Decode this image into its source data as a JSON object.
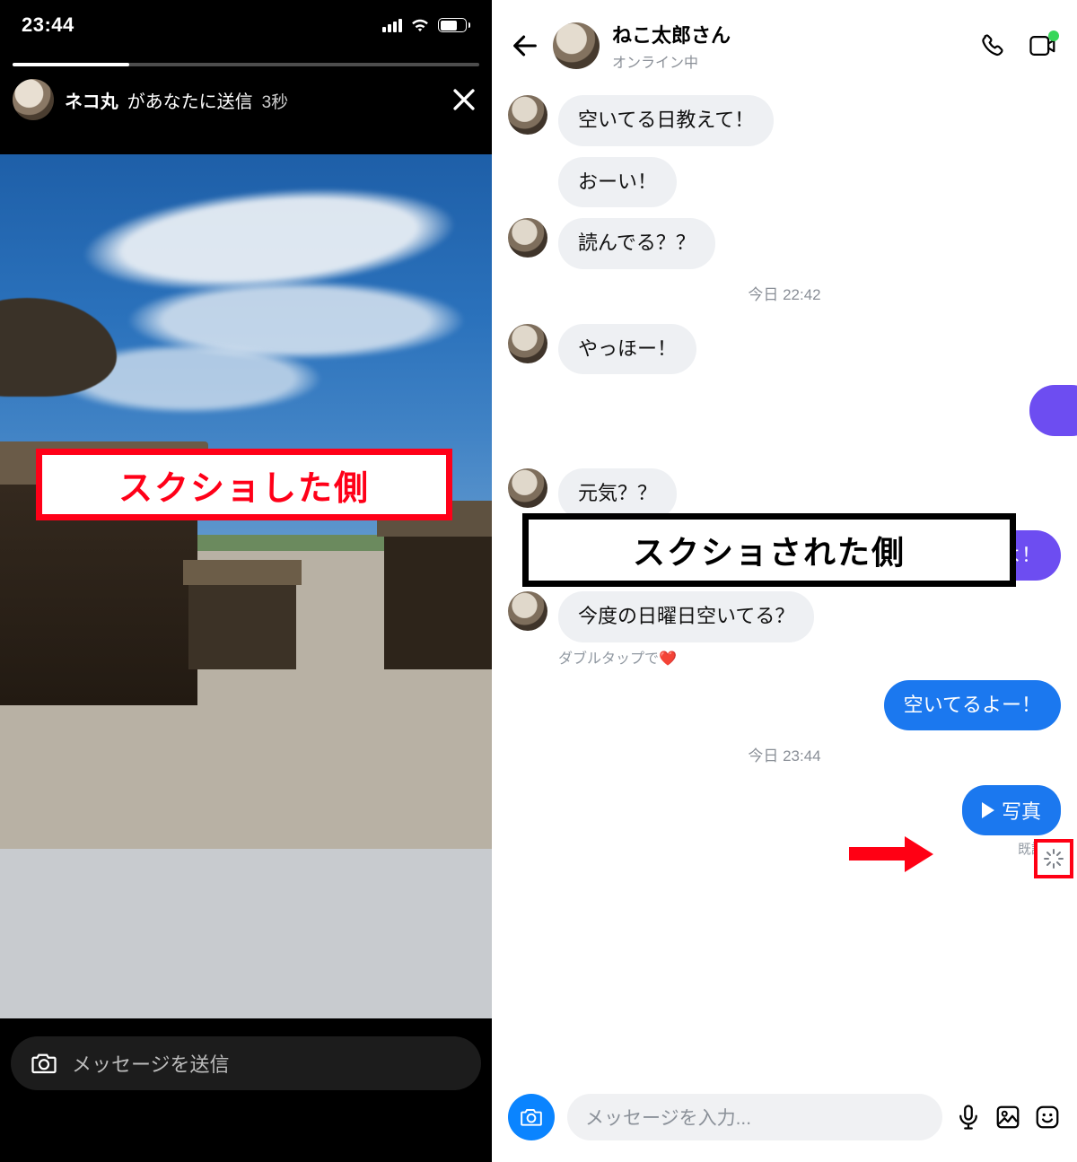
{
  "left": {
    "statusbar": {
      "time": "23:44",
      "battery": "58"
    },
    "story": {
      "sender_name": "ネコ丸",
      "sender_suffix": "があなたに送信",
      "elapsed": "3秒"
    },
    "annotation_label": "スクショした側",
    "input_placeholder": "メッセージを送信"
  },
  "right": {
    "header": {
      "name": "ねこ太郎さん",
      "status": "オンライン中"
    },
    "messages": {
      "m1": "空いてる日教えて！",
      "m2": "おーい！",
      "m3": "読んでる？？",
      "ts1": "今日 22:42",
      "m4": "やっほー！",
      "m5": "元気？？",
      "m6": "元気だよ！",
      "m7": "今度の日曜日空いてる？",
      "hint": "ダブルタップで❤️",
      "m8": "空いてるよー！",
      "ts2": "今日 23:44",
      "photo_label": "写真",
      "read": "既読"
    },
    "annotation_label": "スクショされた側",
    "composer_placeholder": "メッセージを入力..."
  }
}
